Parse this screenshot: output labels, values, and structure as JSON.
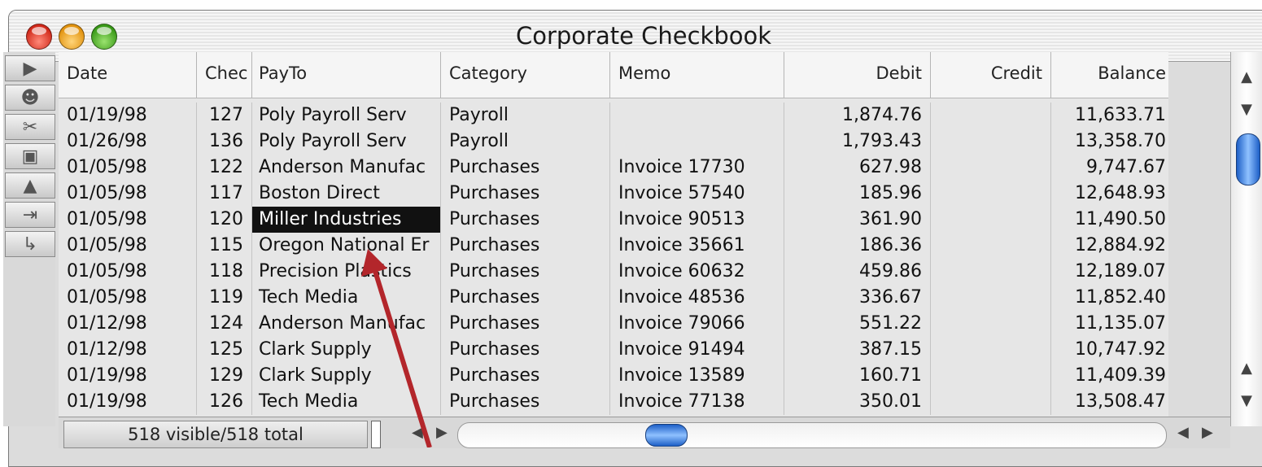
{
  "window": {
    "title": "Corporate Checkbook"
  },
  "toolbar": {
    "tools": [
      {
        "icon": "arrow-right-tool-icon",
        "glyph": "▶"
      },
      {
        "icon": "people-tool-icon",
        "glyph": "☻"
      },
      {
        "icon": "scissors-icon",
        "glyph": "✂"
      },
      {
        "icon": "clipboard-icon",
        "glyph": "▣"
      },
      {
        "icon": "stamp-icon",
        "glyph": "▲"
      },
      {
        "icon": "tab-arrow-icon",
        "glyph": "⇥"
      },
      {
        "icon": "return-arrow-icon",
        "glyph": "↳"
      }
    ]
  },
  "table": {
    "columns": [
      "Date",
      "Chec",
      "PayTo",
      "Category",
      "Memo",
      "Debit",
      "Credit",
      "Balance"
    ],
    "rows": [
      [
        "01/19/98",
        "127",
        "Poly Payroll Serv",
        "Payroll",
        "",
        "1,874.76",
        "",
        "11,633.71"
      ],
      [
        "01/26/98",
        "136",
        "Poly Payroll Serv",
        "Payroll",
        "",
        "1,793.43",
        "",
        "13,358.70"
      ],
      [
        "01/05/98",
        "122",
        "Anderson Manufac",
        "Purchases",
        "Invoice 17730",
        "627.98",
        "",
        "9,747.67"
      ],
      [
        "01/05/98",
        "117",
        "Boston Direct",
        "Purchases",
        "Invoice 57540",
        "185.96",
        "",
        "12,648.93"
      ],
      [
        "01/05/98",
        "120",
        "Miller Industries",
        "Purchases",
        "Invoice 90513",
        "361.90",
        "",
        "11,490.50"
      ],
      [
        "01/05/98",
        "115",
        "Oregon National Er",
        "Purchases",
        "Invoice 35661",
        "186.36",
        "",
        "12,884.92"
      ],
      [
        "01/05/98",
        "118",
        "Precision Plastics",
        "Purchases",
        "Invoice 60632",
        "459.86",
        "",
        "12,189.07"
      ],
      [
        "01/05/98",
        "119",
        "Tech Media",
        "Purchases",
        "Invoice 48536",
        "336.67",
        "",
        "11,852.40"
      ],
      [
        "01/12/98",
        "124",
        "Anderson Manufac",
        "Purchases",
        "Invoice 79066",
        "551.22",
        "",
        "11,135.07"
      ],
      [
        "01/12/98",
        "125",
        "Clark Supply",
        "Purchases",
        "Invoice 91494",
        "387.15",
        "",
        "10,747.92"
      ],
      [
        "01/19/98",
        "129",
        "Clark Supply",
        "Purchases",
        "Invoice 13589",
        "160.71",
        "",
        "11,409.39"
      ],
      [
        "01/19/98",
        "126",
        "Tech Media",
        "Purchases",
        "Invoice 77138",
        "350.01",
        "",
        "13,508.47"
      ]
    ],
    "selected_cell": {
      "row": 4,
      "col": 2
    }
  },
  "status": {
    "record_count": "518 visible/518 total"
  },
  "colors": {
    "selection": "#111111",
    "annotation_arrow": "#b3262b",
    "scroll_thumb": "#3b82f6"
  }
}
